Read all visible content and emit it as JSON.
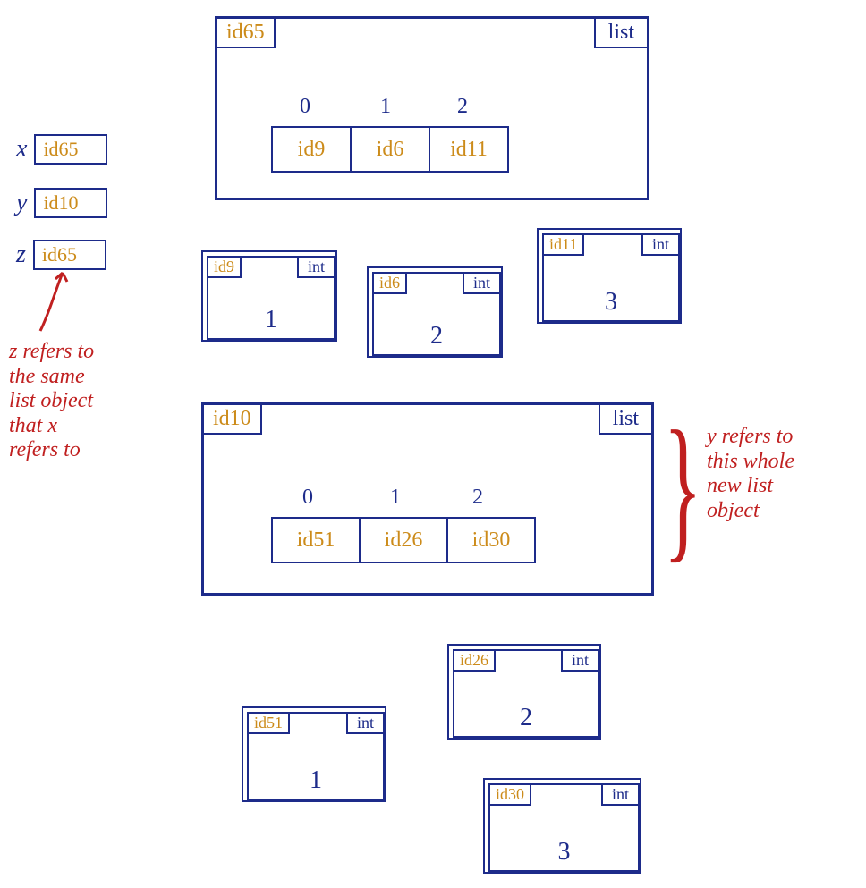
{
  "vars": {
    "x": {
      "name": "x",
      "ref": "id65"
    },
    "y": {
      "name": "y",
      "ref": "id10"
    },
    "z": {
      "name": "z",
      "ref": "id65"
    }
  },
  "list65": {
    "id": "id65",
    "type": "list",
    "indices": [
      "0",
      "1",
      "2"
    ],
    "cells": [
      "id9",
      "id6",
      "id11"
    ]
  },
  "list10": {
    "id": "id10",
    "type": "list",
    "indices": [
      "0",
      "1",
      "2"
    ],
    "cells": [
      "id51",
      "id26",
      "id30"
    ]
  },
  "ints_top": [
    {
      "id": "id9",
      "type": "int",
      "value": "1"
    },
    {
      "id": "id6",
      "type": "int",
      "value": "2"
    },
    {
      "id": "id11",
      "type": "int",
      "value": "3"
    }
  ],
  "ints_bottom": [
    {
      "id": "id51",
      "type": "int",
      "value": "1"
    },
    {
      "id": "id26",
      "type": "int",
      "value": "2"
    },
    {
      "id": "id30",
      "type": "int",
      "value": "3"
    }
  ],
  "annotations": {
    "z_note": "z refers to\nthe same\nlist object\nthat x\nrefers to",
    "y_note": "y refers to\nthis whole\nnew list\nobject"
  }
}
